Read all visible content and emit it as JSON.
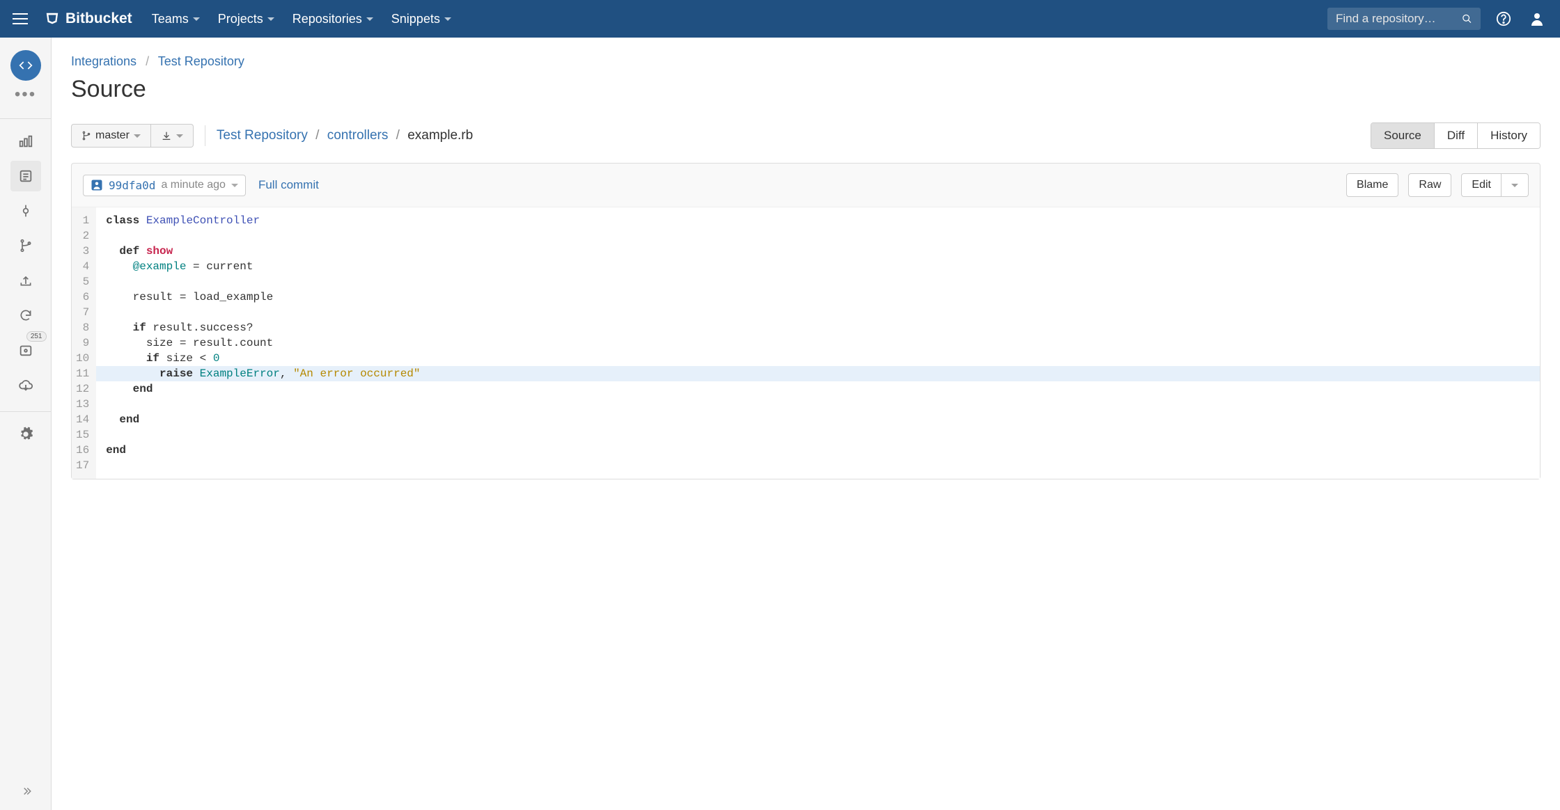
{
  "brand": "Bitbucket",
  "nav": {
    "teams": "Teams",
    "projects": "Projects",
    "repositories": "Repositories",
    "snippets": "Snippets"
  },
  "search": {
    "placeholder": "Find a repository…"
  },
  "sidebar": {
    "badge": "251"
  },
  "breadcrumb": {
    "org": "Integrations",
    "repo": "Test Repository"
  },
  "page_title": "Source",
  "branch": {
    "name": "master"
  },
  "path": {
    "repo": "Test Repository",
    "dir": "controllers",
    "file": "example.rb"
  },
  "view_tabs": {
    "source": "Source",
    "diff": "Diff",
    "history": "History"
  },
  "commit": {
    "hash": "99dfa0d",
    "ago": "a minute ago"
  },
  "actions": {
    "full_commit": "Full commit",
    "blame": "Blame",
    "raw": "Raw",
    "edit": "Edit"
  },
  "code": {
    "tokens": {
      "l1_kw": "class",
      "l1_cls": "ExampleController",
      "l3_kw": "def",
      "l3_name": "show",
      "l4_ivar": "@example",
      "l4_rest": " = current",
      "l6": "    result = load_example",
      "l8_kw": "if",
      "l8_rest": " result.success?",
      "l9": "      size = result.count",
      "l10_kw": "if",
      "l10_mid": " size < ",
      "l10_num": "0",
      "l11_kw": "raise",
      "l11_err": "ExampleError",
      "l11_comma": ", ",
      "l11_str": "\"An error occurred\"",
      "l12": "end",
      "l14": "end",
      "l16": "end"
    },
    "line_count": 17,
    "highlighted_line": 11
  }
}
